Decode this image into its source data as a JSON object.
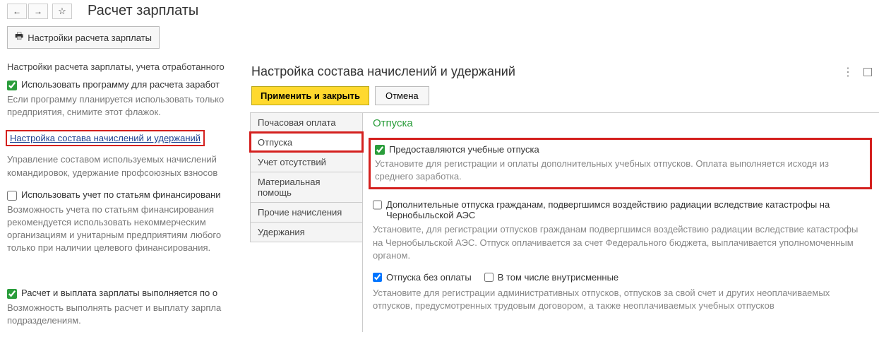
{
  "nav": {
    "back": "←",
    "forward": "→",
    "star": "☆"
  },
  "page": {
    "title": "Расчет зарплаты",
    "settings_btn": "Настройки расчета зарплаты",
    "intro": "Настройки расчета зарплаты, учета отработанного"
  },
  "left": {
    "use_program_label": "Использовать программу для расчета заработ",
    "use_program_desc": "Если программу планируется использовать только предприятия, снимите этот флажок.",
    "config_link": "Настройка состава начислений и удержаний",
    "config_desc": "Управление составом используемых начислений командировок, удержание профсоюзных взносов",
    "by_financing_label": "Использовать учет по статьям финансировани",
    "by_financing_desc": "Возможность учета по статьям финансирования рекомендуется использовать некоммерческим организациям и унитарным предприятиям любого только при наличии целевого финансирования.",
    "payroll_by_label": "Расчет и выплата зарплаты выполняется по о",
    "payroll_by_desc": "Возможность выполнять расчет и выплату зарпла подразделениям."
  },
  "dialog": {
    "title": "Настройка состава начислений и удержаний",
    "apply_close": "Применить и закрыть",
    "cancel": "Отмена",
    "tabs": {
      "hourly": "Почасовая оплата",
      "vacations": "Отпуска",
      "absence": "Учет отсутствий",
      "material": "Материальная помощь",
      "other": "Прочие начисления",
      "deductions": "Удержания"
    },
    "content": {
      "section_title": "Отпуска",
      "study_label": "Предоставляются учебные отпуска",
      "study_desc": "Установите для регистрации и оплаты дополнительных учебных отпусков. Оплата выполняется исходя из среднего заработка.",
      "chernobyl_label": "Дополнительные отпуска гражданам, подвергшимся воздействию радиации вследствие катастрофы на Чернобыльской АЭС",
      "chernobyl_desc": "Установите, для регистрации отпусков гражданам подвергшимся воздействию радиации вследствие катастрофы на Чернобыльской АЭС. Отпуск оплачивается за счет Федерального бюджета, выплачивается уполномоченным органом.",
      "unpaid_label": "Отпуска без оплаты",
      "intrashift_label": "В том числе внутрисменные",
      "unpaid_desc": "Установите для регистрации административных отпусков, отпусков за свой счет и других неоплачиваемых отпусков, предусмотренных трудовым договором, а также неоплачиваемых учебных отпусков"
    }
  }
}
